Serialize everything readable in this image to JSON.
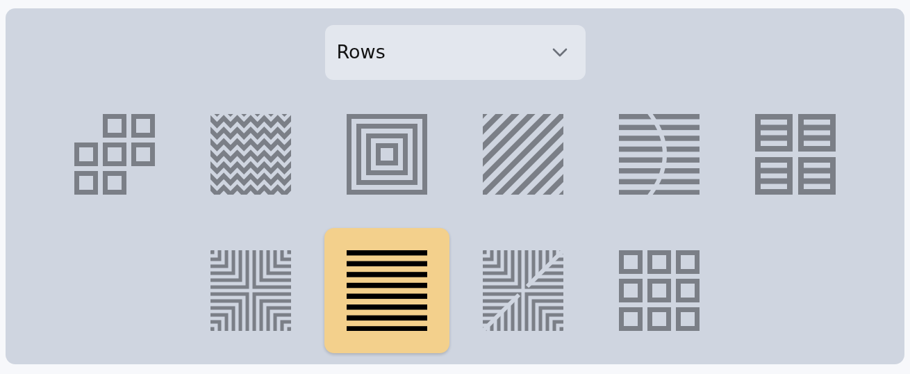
{
  "dropdown": {
    "value": "Rows"
  },
  "patterns": [
    {
      "kind": "blocks",
      "selected": false
    },
    {
      "kind": "zigzag",
      "selected": false
    },
    {
      "kind": "concentric",
      "selected": false
    },
    {
      "kind": "diagonal",
      "selected": false
    },
    {
      "kind": "split-rows",
      "selected": false
    },
    {
      "kind": "quad-rows",
      "selected": false
    },
    {
      "kind": "corners",
      "selected": false
    },
    {
      "kind": "rows",
      "selected": true
    },
    {
      "kind": "corners-diagonal",
      "selected": false
    },
    {
      "kind": "grid",
      "selected": false
    }
  ]
}
